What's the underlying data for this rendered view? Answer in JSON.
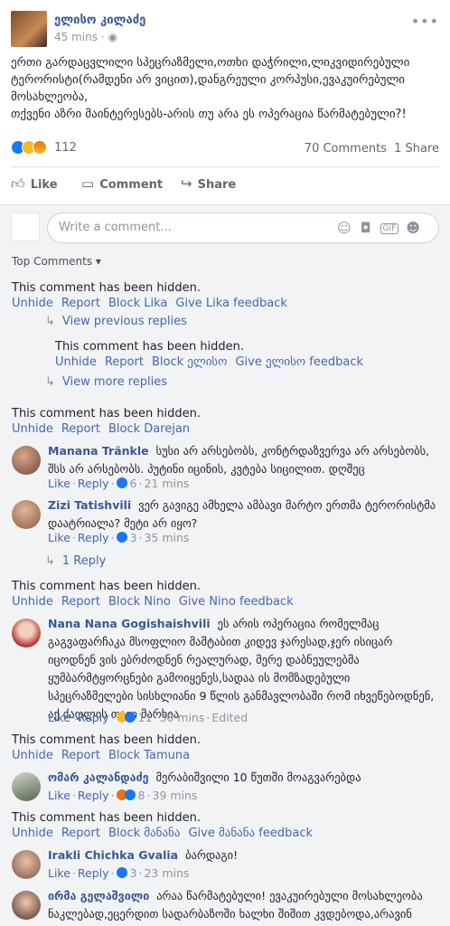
{
  "post": {
    "author": "ელისო კილაძე",
    "time": "45 mins",
    "privacy_sep": "·",
    "text": "ერთი გარდაცვლილი სპეცრაზმელი,ოთხი დაჭრილი,ლიკვიდირებული ტერორისტი(რამდენი არ ვიცით),დანგრეული კორპუსი,ევაკუირებული მოსახლეობა,\nთქვენი აზრი მაინტერესებს-არის თუ არა ეს ოპერაცია წარმატებული?!",
    "reaction_count": "112",
    "comments_count": "70 Comments",
    "shares_count": "1 Share"
  },
  "actions": {
    "like": "Like",
    "comment": "Comment",
    "share": "Share"
  },
  "write_comment": {
    "placeholder": "Write a comment...",
    "gif": "GIF"
  },
  "top_comments": "Top Comments ▾",
  "hidden": {
    "text": "This comment has been hidden.",
    "unhide": "Unhide",
    "report": "Report"
  },
  "blocks": [
    {
      "block": "Block Lika",
      "feedback": "Give Lika feedback"
    },
    {
      "block": "Block ელისო",
      "feedback": "Give ელისო feedback"
    },
    {
      "block": "Block Darejan"
    },
    {
      "block": "Block Nino",
      "feedback": "Give Nino feedback"
    },
    {
      "block": "Block Tamuna"
    },
    {
      "block": "Block მანანა",
      "feedback": "Give მანანა feedback"
    }
  ],
  "view_previous": "View previous replies",
  "view_more": "View more replies",
  "one_reply": "1 Reply",
  "comment_meta": {
    "like": "Like",
    "reply": "Reply",
    "edited": "Edited"
  },
  "comments": [
    {
      "name": "Manana Tränkle",
      "text": "სუსი არ არსებობს, კონტრდაზვერვა არ არსებობს, შსს არ არსებობს. პუტინი იცინის, კვტება სიცილით. დღშეც",
      "likes": "6",
      "time": "21 mins"
    },
    {
      "name": "Zizi Tatishvili",
      "text": "ვერ გავიგე ამხელა ამბავი მარტო ერთმა ტერორისტმა დაატრიალა? მეტი არ იყო?",
      "likes": "3",
      "time": "35 mins"
    },
    {
      "name": "Nana Nana Gogishaishvili",
      "text": "ეს არის ოპერაცია რომელმაც გაგვაფარჩაკა მსოფლიო მაშტაბით კიდევ ჯარესად,ჯერ ისიცარ იცოდნენ ვის ებრძოდნენ რეალურად, მერე დაბნეულებმა ყუმბარმტყორცნები გამოიყენეს,სადაა ის მომზადებული სპეცრაზმელები სისხლიანი 9 წლის განმავლობაში რომ იხვეწებოდნენ, აქ ძაღლის თავი მარხია",
      "likes": "11",
      "time": "30 mins"
    },
    {
      "name": "ომარ კალანდაძე",
      "text": "მერაბიშვილი 10 წუთში მოაგვარებდა",
      "likes": "8",
      "time": "39 mins"
    },
    {
      "name": "Irakli Chichka Gvalia",
      "text": "ბარდაგი!",
      "likes": "3",
      "time": "23 mins"
    },
    {
      "name": "ირმა გელაშვილი",
      "text": "არაა წარმატებული! ევაკუირებული მოსახლეობა ნაკლებად,ეცერდით სადარბაზოში ხალხი შიშით კვდებოდა,არავინ",
      "likes": "",
      "time": ""
    }
  ],
  "colors": {
    "link": "#4267b2",
    "name": "#385898",
    "bg_comments": "#f2f3f5"
  }
}
